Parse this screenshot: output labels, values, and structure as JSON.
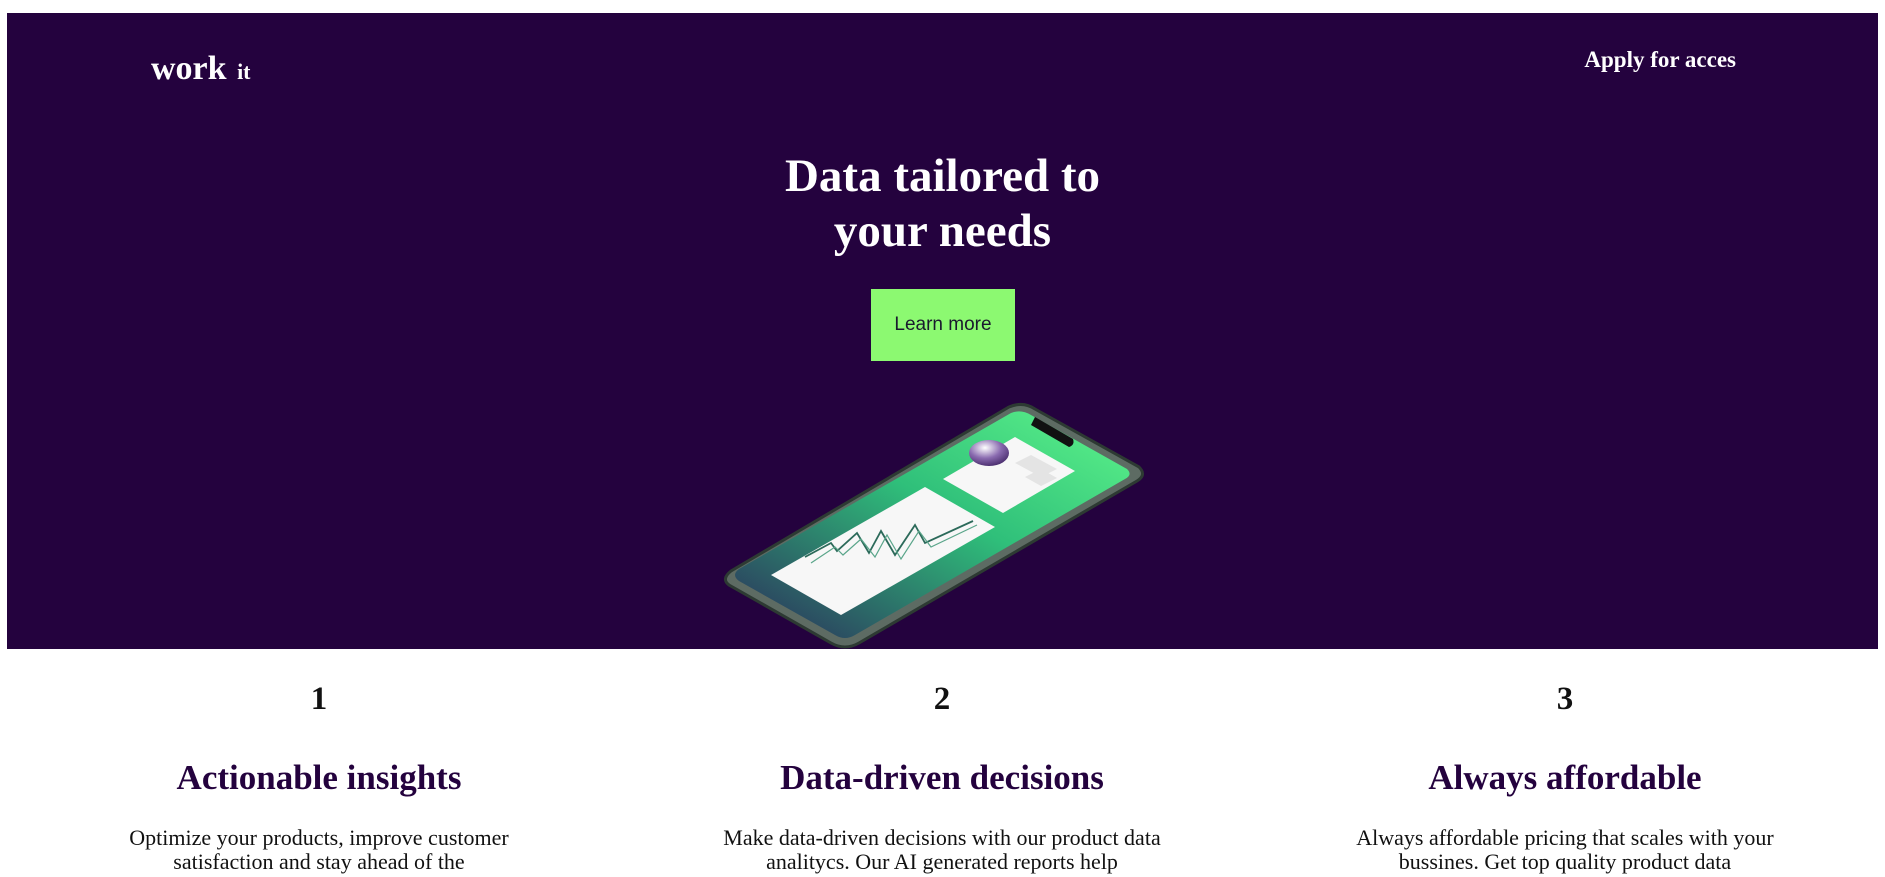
{
  "header": {
    "logo_main": "work",
    "logo_small": "it",
    "nav_link": "Apply for acces"
  },
  "hero": {
    "title_line1": "Data tailored to",
    "title_line2": "your needs",
    "cta_label": "Learn more"
  },
  "features": [
    {
      "number": "1",
      "title": "Actionable insights",
      "description": "Optimize your products, improve customer satisfaction and stay ahead of the"
    },
    {
      "number": "2",
      "title": "Data-driven decisions",
      "description": "Make data-driven decisions with our product data analitycs. Our AI generated reports help"
    },
    {
      "number": "3",
      "title": "Always affordable",
      "description": "Always affordable pricing that scales with your bussines. Get top quality product data"
    }
  ],
  "colors": {
    "hero_bg": "#24023e",
    "cta_bg": "#8cf971",
    "title_accent": "#24023e"
  },
  "icons": {
    "hero_illustration": "smartphone-analytics-illustration"
  }
}
